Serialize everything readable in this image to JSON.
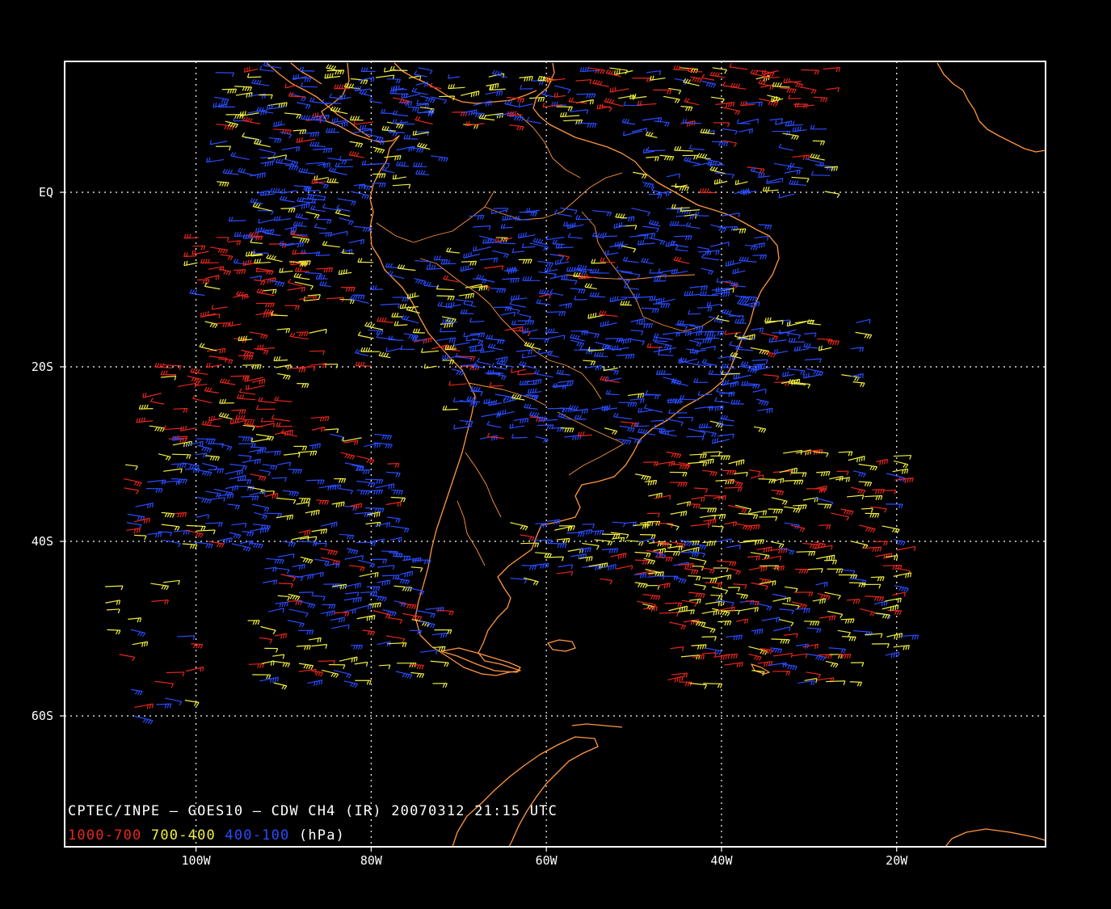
{
  "map": {
    "lon_range": [
      -115,
      -3
    ],
    "lat_range": [
      15,
      -75
    ],
    "x_axis": {
      "ticks": [
        {
          "value": -100,
          "label": "100W"
        },
        {
          "value": -80,
          "label": "80W"
        },
        {
          "value": -60,
          "label": "60W"
        },
        {
          "value": -40,
          "label": "40W"
        },
        {
          "value": -20,
          "label": "20W"
        }
      ]
    },
    "y_axis": {
      "ticks": [
        {
          "value": 0,
          "label": "EQ"
        },
        {
          "value": -20,
          "label": "20S"
        },
        {
          "value": -40,
          "label": "40S"
        },
        {
          "value": -60,
          "label": "60S"
        }
      ]
    },
    "grid": true,
    "background_color": "#000000",
    "frame_color": "#ffffff",
    "coastline_color": "#ff9640"
  },
  "caption": {
    "title": "CPTEC/INPE — GOES10 — CDW CH4 (IR) 20070312 21:15 UTC",
    "legend": [
      {
        "text": "1000-700",
        "color": "#e8261e"
      },
      {
        "text": "700-400",
        "color": "#f0f040"
      },
      {
        "text": "400-100",
        "color": "#2a4cff"
      },
      {
        "text": "(hPa)",
        "color": "#ffffff"
      }
    ]
  },
  "wind_layers": [
    {
      "name": "1000-700",
      "color": "#e8261e"
    },
    {
      "name": "700-400",
      "color": "#f0f040"
    },
    {
      "name": "400-100",
      "color": "#2a4cff"
    }
  ]
}
